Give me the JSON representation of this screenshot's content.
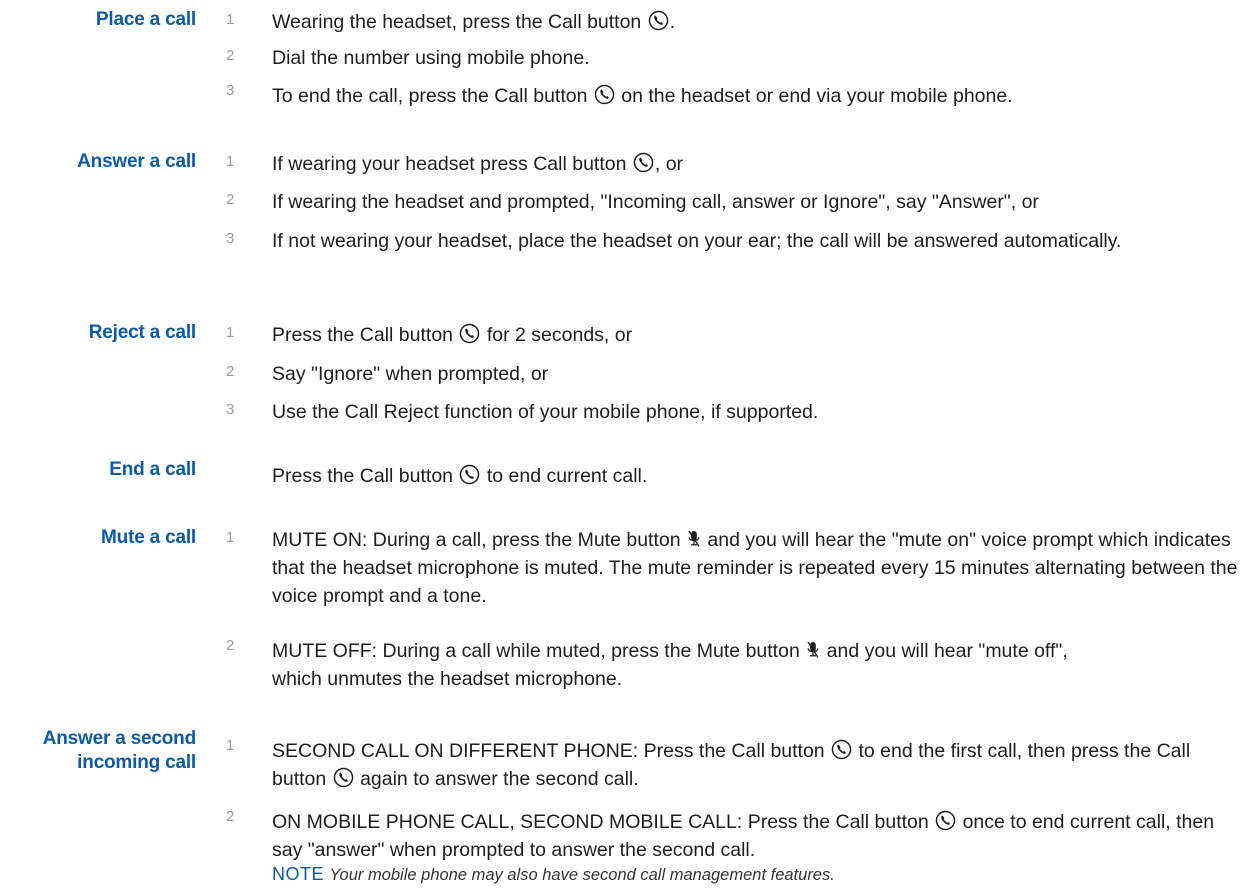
{
  "sections": [
    {
      "title": "Place a call",
      "steps": [
        {
          "num": "1",
          "before": "Wearing the headset, press the Call button",
          "after": "."
        },
        {
          "num": "2",
          "text": "Dial the number using mobile phone."
        },
        {
          "num": "3",
          "before": "To end the call, press the Call button",
          "after": "on the headset or end via your mobile phone."
        }
      ]
    },
    {
      "title": "Answer a call",
      "steps": [
        {
          "num": "1",
          "before": "If wearing your headset press Call button",
          "after": ", or"
        },
        {
          "num": "2",
          "text": "If wearing the headset and prompted, \"Incoming call, answer or Ignore\", say \"Answer\", or"
        },
        {
          "num": "3",
          "text": "If not wearing your headset, place the headset on your ear; the call will be answered automatically."
        }
      ]
    },
    {
      "title": "Reject a call",
      "steps": [
        {
          "num": "1",
          "before": "Press the Call button",
          "after": "for 2 seconds, or"
        },
        {
          "num": "2",
          "text": "Say \"Ignore\" when prompted, or"
        },
        {
          "num": "3",
          "text": "Use the Call Reject function of your mobile phone, if supported."
        }
      ]
    },
    {
      "title": "End a call",
      "steps": [
        {
          "before": "Press the Call button",
          "after": "to end current call."
        }
      ]
    },
    {
      "title": "Mute a call",
      "steps": [
        {
          "num": "1",
          "before": "MUTE ON: During a call, press the Mute button",
          "after": "and you will hear the \"mute on\" voice prompt which indicates that the headset microphone is muted. The mute reminder is repeated every 15 minutes alternating between the voice prompt and a tone."
        },
        {
          "num": "2",
          "before": "MUTE OFF: During a call while muted, press the Mute button",
          "after": "and you will hear \"mute off\", which unmutes the headset microphone."
        }
      ]
    },
    {
      "title_line1": "Answer a second",
      "title_line2": "incoming call",
      "steps": [
        {
          "num": "1",
          "before": "SECOND CALL ON DIFFERENT PHONE: Press the Call button",
          "middle": "to end the first call, then press the Call button",
          "after": "again to answer the second call."
        },
        {
          "num": "2",
          "before": "ON MOBILE PHONE CALL, SECOND MOBILE CALL: Press the Call button",
          "after": "once to end current call, then say \"answer\" when prompted to answer the second call."
        }
      ],
      "note_label": "NOTE",
      "note_text": "Your mobile phone may also have second call management features."
    }
  ],
  "icons": {
    "call": "call-button-icon",
    "mute": "mute-button-icon"
  },
  "colors": {
    "heading": "#0b5aa8",
    "step_number": "#9a9a9a",
    "body_text": "#1e1e1e"
  }
}
